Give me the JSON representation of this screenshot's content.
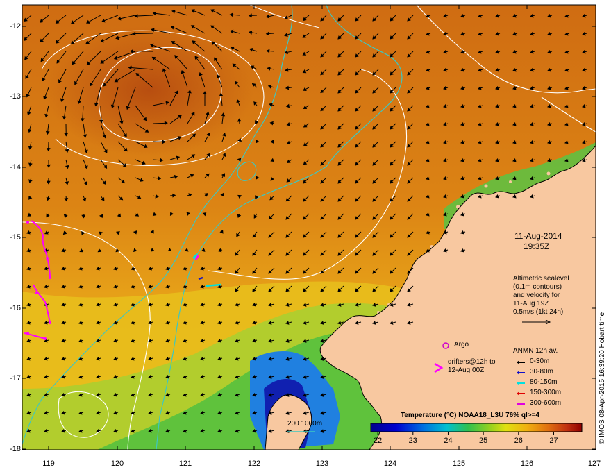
{
  "map": {
    "date": "11-Aug-2014",
    "time": "19:35Z",
    "y_ticks": [
      "-12",
      "-13",
      "-14",
      "-15",
      "-16",
      "-17",
      "-18"
    ],
    "x_ticks": [
      "119",
      "120",
      "121",
      "122",
      "123",
      "124",
      "125",
      "126",
      "127"
    ],
    "x_range": [
      118.6,
      127
    ],
    "y_range": [
      -18,
      -11.7
    ]
  },
  "sealevel_legend": {
    "line1": "Altimetric sealevel",
    "line2": "(0.1m contours)",
    "line3": "and velocity for",
    "line4": "11-Aug 19Z",
    "line5": "0.5m/s (1kt 24h)"
  },
  "markers": {
    "argo_label": "Argo",
    "drifters_line1": "drifters@12h to",
    "drifters_line2": "12-Aug 00Z"
  },
  "anmn": {
    "title": "ANMN 12h av.",
    "items": [
      {
        "label": "0-30m",
        "color": "#000000"
      },
      {
        "label": "30-80m",
        "color": "#1010c8"
      },
      {
        "label": "80-150m",
        "color": "#00e0e0"
      },
      {
        "label": "150-300m",
        "color": "#e00000"
      },
      {
        "label": "300-600m",
        "color": "#e000e0"
      }
    ]
  },
  "depth_legend": {
    "label": "200  1000m",
    "color": "#3ec7c0"
  },
  "colorbar": {
    "title": "Temperature (°C) NOAA18_L3U 76% ql>=4",
    "ticks": [
      "22",
      "23",
      "24",
      "25",
      "26",
      "27"
    ],
    "range": [
      21.8,
      27.8
    ]
  },
  "credit": "© IMOS 08-Apr-2015 16:39:20 Hobart time",
  "colors": {
    "land": "#f8c8a0",
    "sea_warm": "#d9780f",
    "sea_cool": "#e6a21a",
    "contour": "#ffffff",
    "bathymetry": "#3ec7c0",
    "drifter": "#ff00ff",
    "argo": "#cc00cc"
  }
}
